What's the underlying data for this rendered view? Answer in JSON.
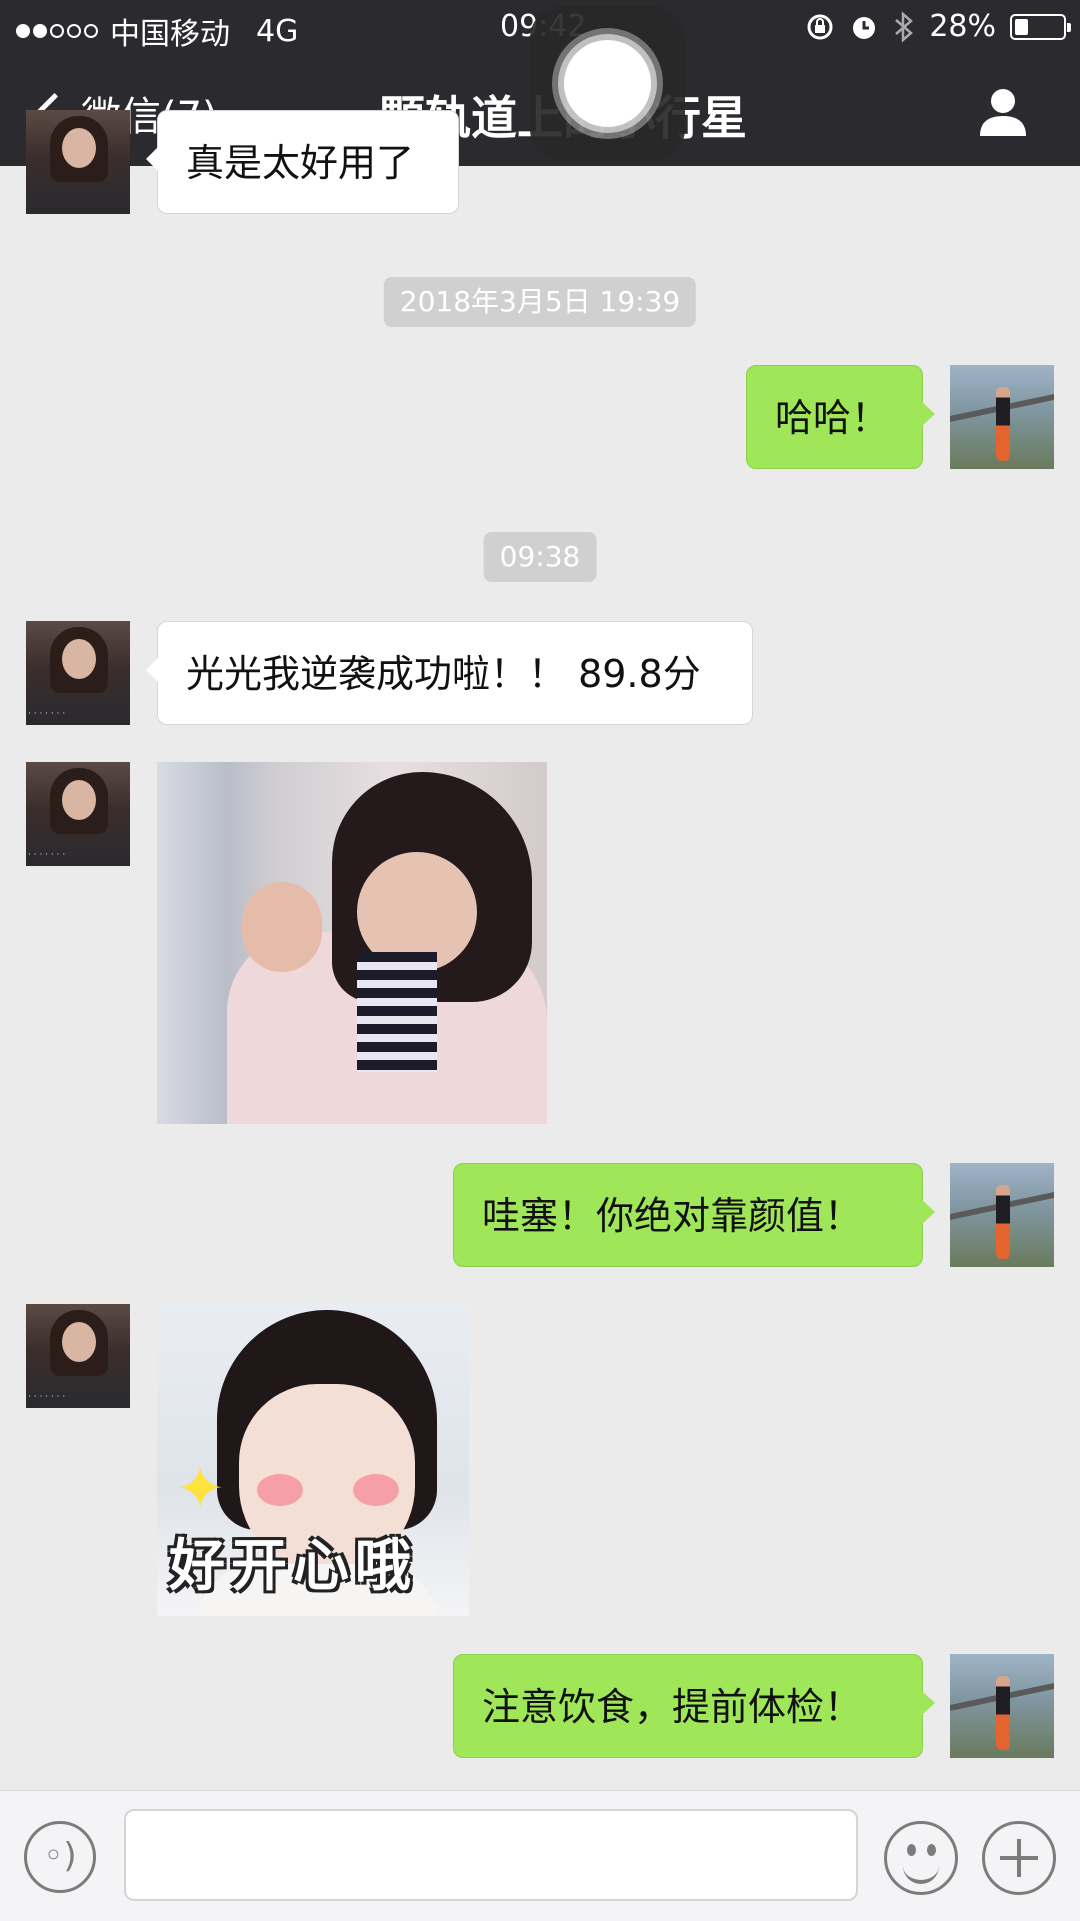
{
  "status_bar": {
    "carrier": "中国移动",
    "network": "4G",
    "time": "09:42",
    "battery_text": "28%",
    "battery_level": 0.28
  },
  "nav": {
    "back_label": "微信(7)",
    "title": "一颗轨道上的小行星"
  },
  "messages": {
    "partial_text": "真是太好用了",
    "timestamp_1": "2018年3月5日 19:39",
    "msg_haha": "哈哈！",
    "timestamp_2": "09:38",
    "msg_success": "光光我逆袭成功啦！！ 89.8分",
    "msg_wow": "哇塞！你绝对靠颜值！",
    "sticker_2_caption": "好开心哦",
    "msg_diet": "注意饮食，提前体检！"
  }
}
